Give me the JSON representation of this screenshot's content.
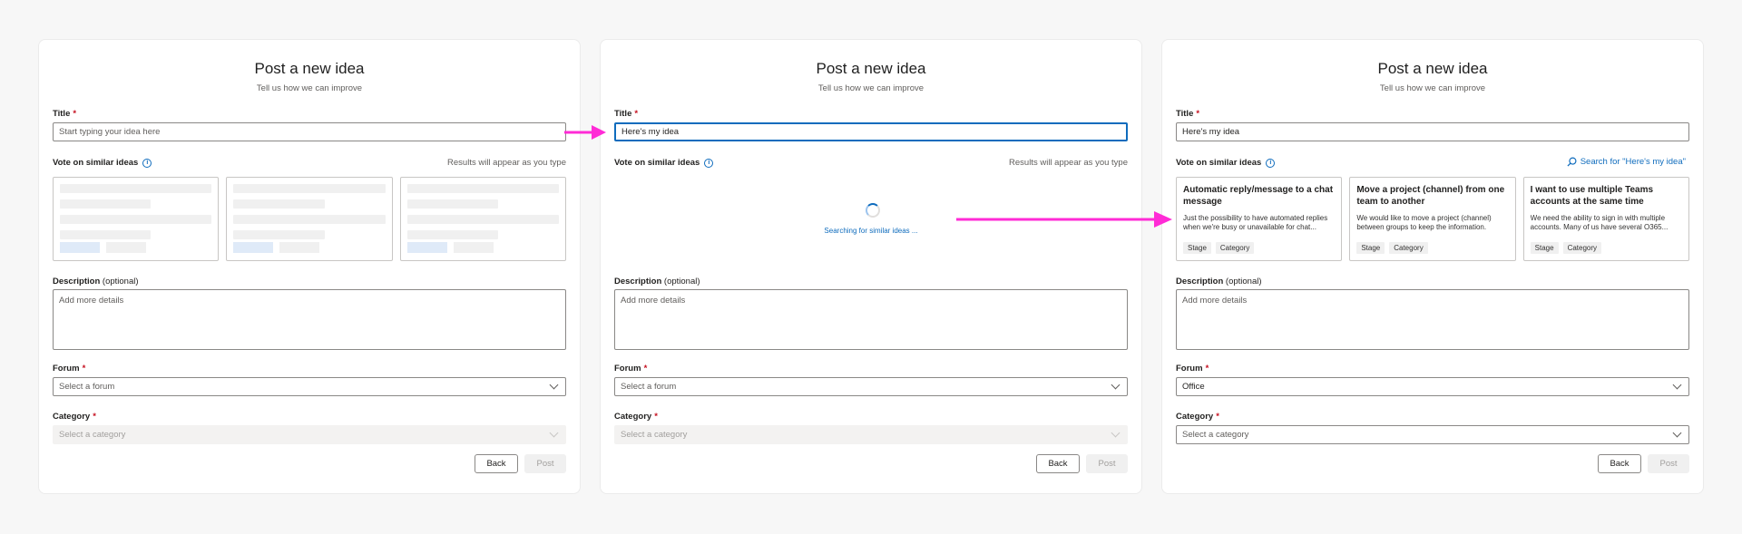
{
  "screens": [
    {
      "title": "Post a new idea",
      "subtitle": "Tell us how we can improve",
      "title_label": "Title",
      "title_placeholder": "Start typing your idea here",
      "vote_label": "Vote on similar ideas",
      "vote_hint": "Results will appear as you type",
      "description_label": "Description",
      "description_optional": "(optional)",
      "description_placeholder": "Add more details",
      "forum_label": "Forum",
      "forum_value": "Select a forum",
      "category_label": "Category",
      "category_value": "Select a category",
      "back_label": "Back",
      "post_label": "Post"
    },
    {
      "title": "Post a new idea",
      "subtitle": "Tell us how we can improve",
      "title_label": "Title",
      "title_value": "Here's my idea",
      "vote_label": "Vote on similar ideas",
      "vote_hint": "Results will appear as you type",
      "searching_text": "Searching for similar ideas ...",
      "description_label": "Description",
      "description_optional": "(optional)",
      "description_placeholder": "Add more details",
      "forum_label": "Forum",
      "forum_value": "Select a forum",
      "category_label": "Category",
      "category_value": "Select a category",
      "back_label": "Back",
      "post_label": "Post"
    },
    {
      "title": "Post a new idea",
      "subtitle": "Tell us how we can improve",
      "title_label": "Title",
      "title_value": "Here's my idea",
      "vote_label": "Vote on similar ideas",
      "search_link": "Search for \"Here's my idea\"",
      "cards": [
        {
          "title": "Automatic reply/message to a chat message",
          "body": "Just the possibility to have automated replies when we're busy or unavailable for chat...",
          "tag1": "Stage",
          "tag2": "Category"
        },
        {
          "title": "Move a project (channel) from one team to another",
          "body": "We would like to move a project (channel) between groups to keep the information.",
          "tag1": "Stage",
          "tag2": "Category"
        },
        {
          "title": "I want to use multiple Teams accounts at the same time",
          "body": "We need the ability to sign in with multiple accounts. Many of us have several O365...",
          "tag1": "Stage",
          "tag2": "Category"
        }
      ],
      "description_label": "Description",
      "description_optional": "(optional)",
      "description_placeholder": "Add more details",
      "forum_label": "Forum",
      "forum_value": "Office",
      "category_label": "Category",
      "category_value": "Select a category",
      "back_label": "Back",
      "post_label": "Post"
    }
  ],
  "colors": {
    "accent": "#0f6cbd",
    "arrow": "#ff2bd6",
    "required": "#c50f1f"
  },
  "icons": [
    "info-icon",
    "chevron-down-icon",
    "search-icon",
    "spinner-icon",
    "arrow-icon"
  ]
}
